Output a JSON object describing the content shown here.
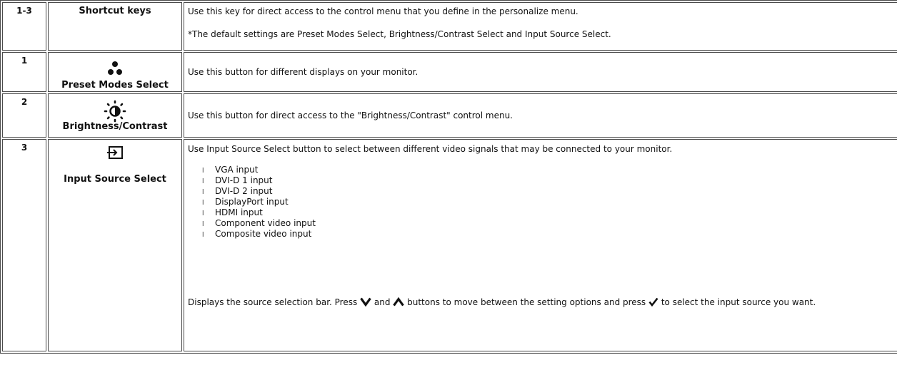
{
  "rows": [
    {
      "num": "1-3",
      "name": "Shortcut keys",
      "desc": [
        "Use this key for direct access to the control menu that you define in the personalize menu.",
        "*The default settings are Preset Modes Select, Brightness/Contrast Select and Input Source Select."
      ]
    },
    {
      "num": "1",
      "icon": "preset-modes-icon",
      "name": "Preset Modes Select",
      "desc": "Use this button for different displays on your monitor."
    },
    {
      "num": "2",
      "icon": "brightness-contrast-icon",
      "name": "Brightness/Contrast",
      "desc": "Use this button for direct access to the \"Brightness/Contrast\" control menu."
    },
    {
      "num": "3",
      "icon": "input-source-icon",
      "name": "Input Source Select",
      "intro": "Use Input Source Select button to select between different video signals that may be connected to your monitor.",
      "bullet_char": "l",
      "sources": [
        "VGA input",
        "DVI-D 1 input",
        "DVI-D 2 input",
        "DisplayPort input",
        "HDMI input",
        "Component video input",
        "Composite video input"
      ],
      "outro_1": "Displays the source selection bar. Press",
      "outro_2": "and",
      "outro_3": "buttons to move between the setting options and press",
      "outro_4": "to select the input source you want."
    }
  ]
}
